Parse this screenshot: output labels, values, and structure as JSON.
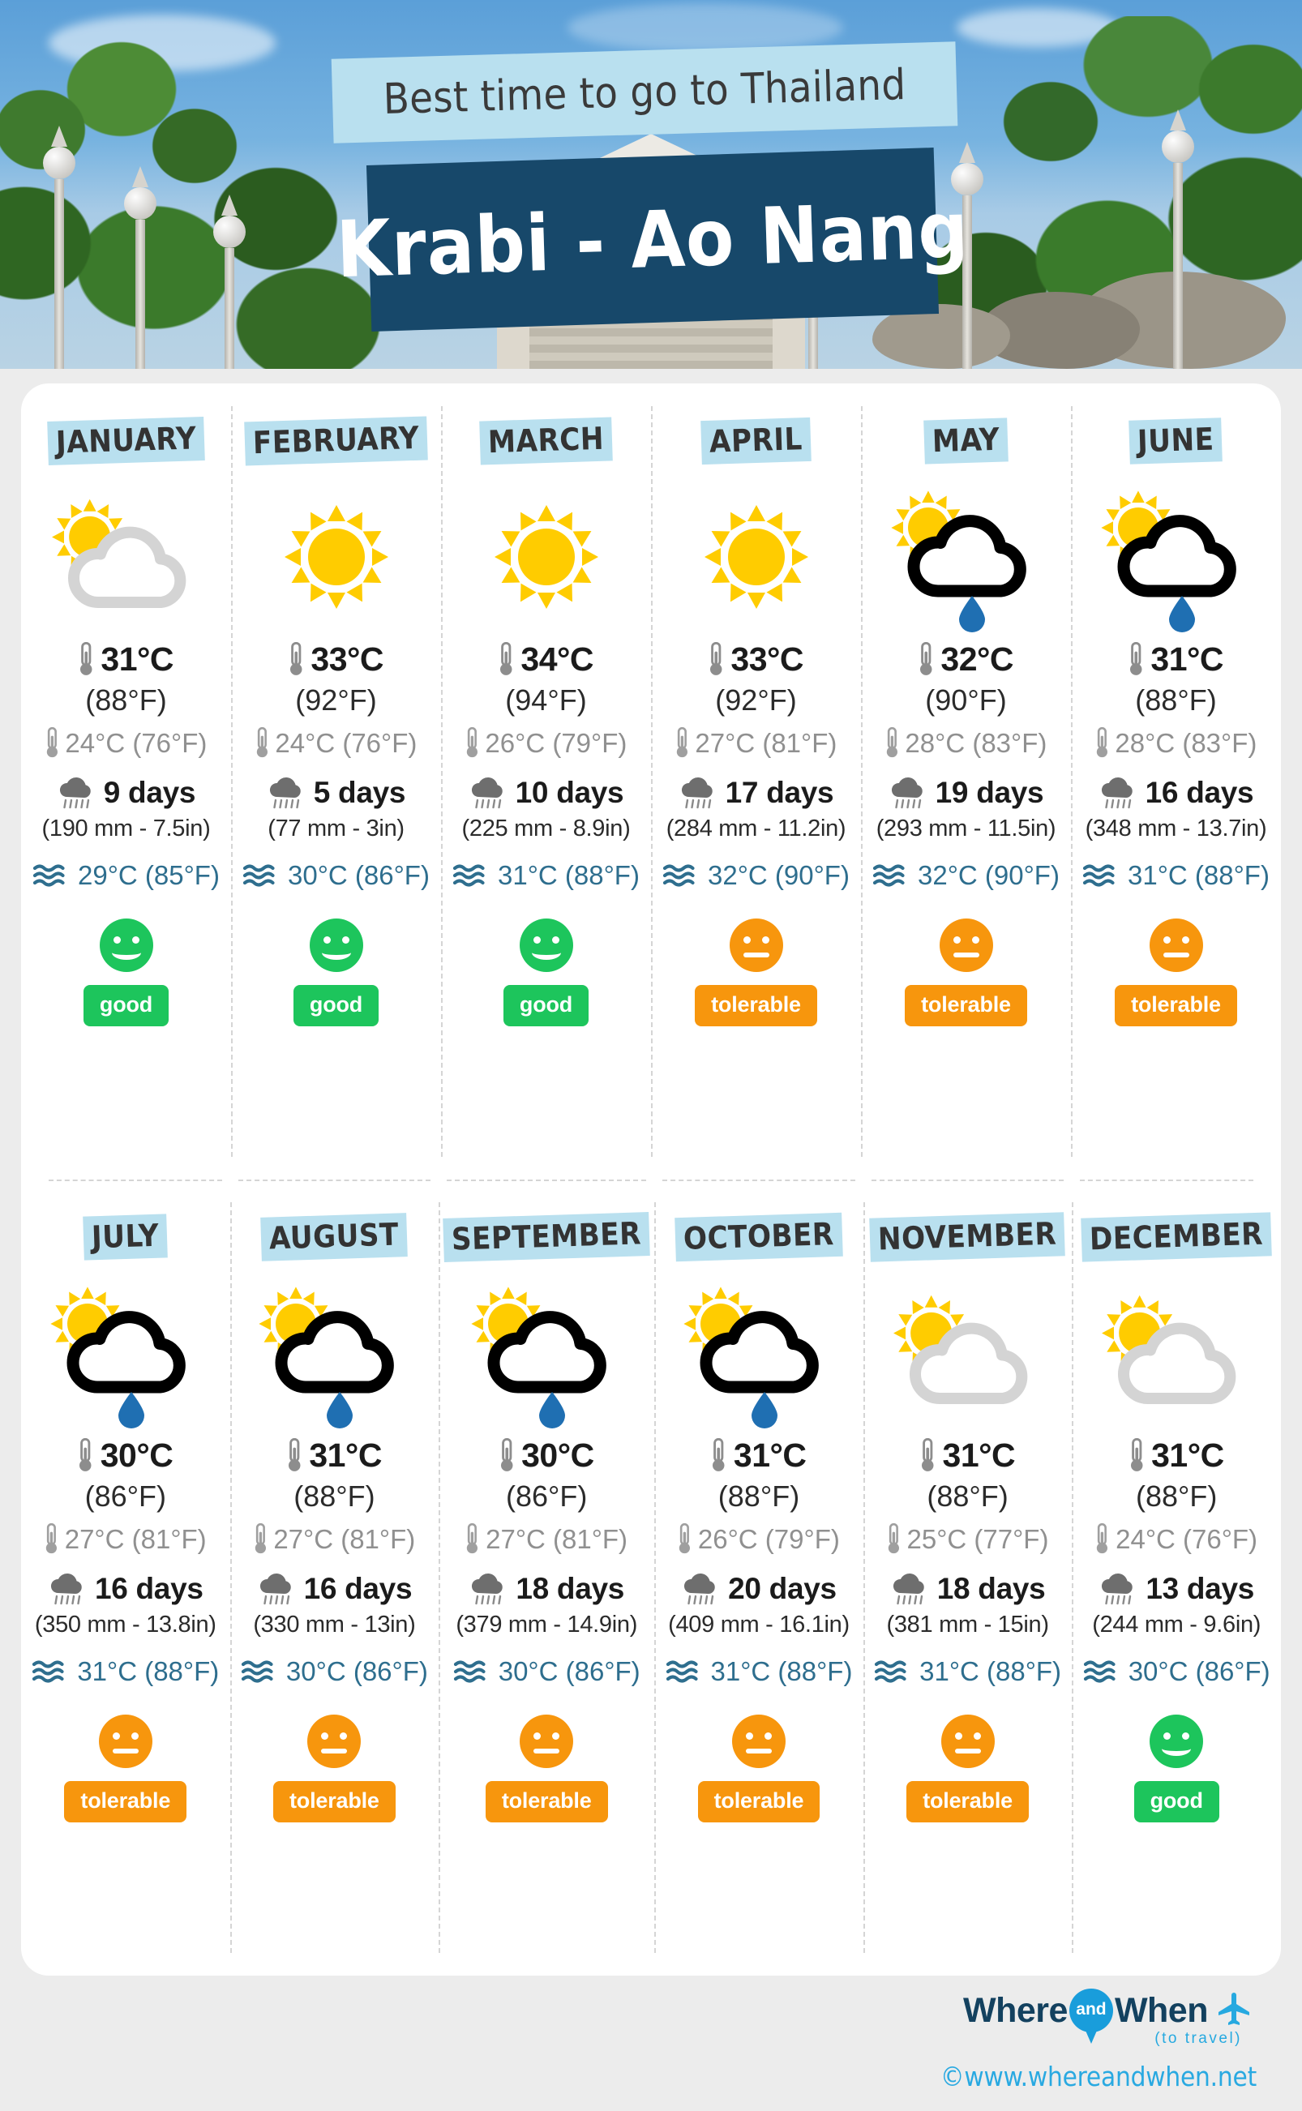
{
  "header": {
    "subtitle": "Best time to go to Thailand",
    "title": "Krabi - Ao Nang",
    "subtitle_bg": "#b9e0ef",
    "title_bg": "#17486a"
  },
  "colors": {
    "accent_light_blue": "#b9e0ef",
    "dark_blue": "#17486a",
    "sun_yellow": "#FFCC00",
    "cloud_grey": "#d4d4d4",
    "cloud_black": "#000000",
    "raindrop_blue": "#1f6fb2",
    "sea_text": "#2e6e8e",
    "good_green": "#1dc55c",
    "tolerable_orange": "#f7960d"
  },
  "icons": {
    "thermometer_max": "thermometer-icon",
    "thermometer_min": "thermometer-icon",
    "rain_days": "rain-cloud-icon",
    "sea": "waves-icon"
  },
  "months": [
    {
      "name": "JANUARY",
      "weather_icon": "sun-behind-cloud-icon",
      "temp_max_c": "31°C",
      "temp_max_f": "(88°F)",
      "temp_min": "24°C (76°F)",
      "rain_days": "9 days",
      "rain_amount": "(190 mm - 7.5in)",
      "sea_temp": "29°C (85°F)",
      "rating": "good",
      "rating_label": "good",
      "face": "smile"
    },
    {
      "name": "FEBRUARY",
      "weather_icon": "sun-icon",
      "temp_max_c": "33°C",
      "temp_max_f": "(92°F)",
      "temp_min": "24°C (76°F)",
      "rain_days": "5 days",
      "rain_amount": "(77 mm - 3in)",
      "sea_temp": "30°C (86°F)",
      "rating": "good",
      "rating_label": "good",
      "face": "smile"
    },
    {
      "name": "MARCH",
      "weather_icon": "sun-icon",
      "temp_max_c": "34°C",
      "temp_max_f": "(94°F)",
      "temp_min": "26°C (79°F)",
      "rain_days": "10 days",
      "rain_amount": "(225 mm - 8.9in)",
      "sea_temp": "31°C (88°F)",
      "rating": "good",
      "rating_label": "good",
      "face": "smile"
    },
    {
      "name": "APRIL",
      "weather_icon": "sun-icon",
      "temp_max_c": "33°C",
      "temp_max_f": "(92°F)",
      "temp_min": "27°C (81°F)",
      "rain_days": "17 days",
      "rain_amount": "(284 mm - 11.2in)",
      "sea_temp": "32°C (90°F)",
      "rating": "tolerable",
      "rating_label": "tolerable",
      "face": "flat"
    },
    {
      "name": "MAY",
      "weather_icon": "sun-cloud-rain-icon",
      "temp_max_c": "32°C",
      "temp_max_f": "(90°F)",
      "temp_min": "28°C (83°F)",
      "rain_days": "19 days",
      "rain_amount": "(293 mm - 11.5in)",
      "sea_temp": "32°C (90°F)",
      "rating": "tolerable",
      "rating_label": "tolerable",
      "face": "flat"
    },
    {
      "name": "JUNE",
      "weather_icon": "sun-cloud-rain-icon",
      "temp_max_c": "31°C",
      "temp_max_f": "(88°F)",
      "temp_min": "28°C (83°F)",
      "rain_days": "16 days",
      "rain_amount": "(348 mm - 13.7in)",
      "sea_temp": "31°C (88°F)",
      "rating": "tolerable",
      "rating_label": "tolerable",
      "face": "flat"
    },
    {
      "name": "JULY",
      "weather_icon": "sun-cloud-rain-icon",
      "temp_max_c": "30°C",
      "temp_max_f": "(86°F)",
      "temp_min": "27°C (81°F)",
      "rain_days": "16 days",
      "rain_amount": "(350 mm - 13.8in)",
      "sea_temp": "31°C (88°F)",
      "rating": "tolerable",
      "rating_label": "tolerable",
      "face": "flat"
    },
    {
      "name": "AUGUST",
      "weather_icon": "sun-cloud-rain-icon",
      "temp_max_c": "31°C",
      "temp_max_f": "(88°F)",
      "temp_min": "27°C (81°F)",
      "rain_days": "16 days",
      "rain_amount": "(330 mm - 13in)",
      "sea_temp": "30°C (86°F)",
      "rating": "tolerable",
      "rating_label": "tolerable",
      "face": "flat"
    },
    {
      "name": "SEPTEMBER",
      "weather_icon": "sun-cloud-rain-icon",
      "temp_max_c": "30°C",
      "temp_max_f": "(86°F)",
      "temp_min": "27°C (81°F)",
      "rain_days": "18 days",
      "rain_amount": "(379 mm - 14.9in)",
      "sea_temp": "30°C (86°F)",
      "rating": "tolerable",
      "rating_label": "tolerable",
      "face": "flat"
    },
    {
      "name": "OCTOBER",
      "weather_icon": "sun-cloud-rain-icon",
      "temp_max_c": "31°C",
      "temp_max_f": "(88°F)",
      "temp_min": "26°C (79°F)",
      "rain_days": "20 days",
      "rain_amount": "(409 mm - 16.1in)",
      "sea_temp": "31°C (88°F)",
      "rating": "tolerable",
      "rating_label": "tolerable",
      "face": "flat"
    },
    {
      "name": "NOVEMBER",
      "weather_icon": "sun-behind-cloud-icon",
      "temp_max_c": "31°C",
      "temp_max_f": "(88°F)",
      "temp_min": "25°C (77°F)",
      "rain_days": "18 days",
      "rain_amount": "(381 mm - 15in)",
      "sea_temp": "31°C (88°F)",
      "rating": "tolerable",
      "rating_label": "tolerable",
      "face": "flat"
    },
    {
      "name": "DECEMBER",
      "weather_icon": "sun-behind-cloud-icon",
      "temp_max_c": "31°C",
      "temp_max_f": "(88°F)",
      "temp_min": "24°C (76°F)",
      "rain_days": "13 days",
      "rain_amount": "(244 mm - 9.6in)",
      "sea_temp": "30°C (86°F)",
      "rating": "good",
      "rating_label": "good",
      "face": "smile"
    }
  ],
  "footer": {
    "logo_where": "Where",
    "logo_and": "and",
    "logo_when": "When",
    "logo_tagline": "(to travel)",
    "url": "©www.whereandwhen.net"
  }
}
